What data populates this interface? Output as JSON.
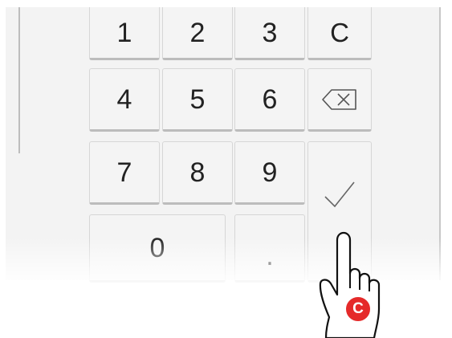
{
  "keypad": {
    "keys": {
      "one": "1",
      "two": "2",
      "three": "3",
      "clear": "C",
      "four": "4",
      "five": "5",
      "six": "6",
      "seven": "7",
      "eight": "8",
      "nine": "9",
      "zero": "0",
      "decimal": "."
    },
    "icons": {
      "backspace": "backspace-icon",
      "confirm": "checkmark-icon"
    }
  },
  "overlay": {
    "cursor_icon": "hand-pointer-icon",
    "badge_letter": "C",
    "badge_color": "#e52a2a"
  }
}
